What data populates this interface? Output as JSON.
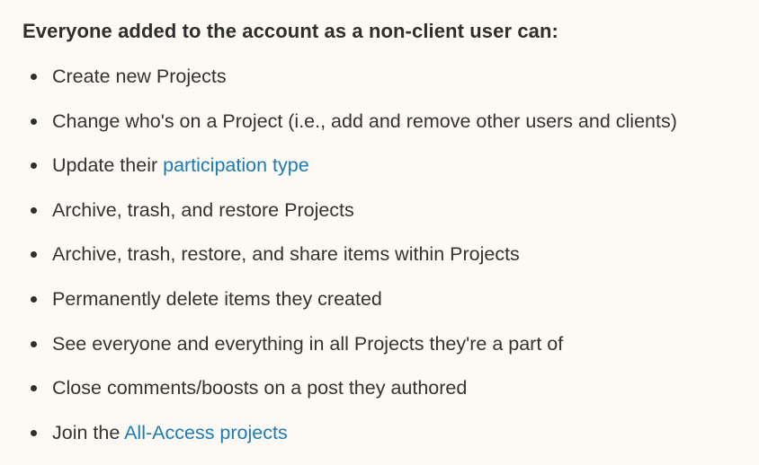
{
  "heading": "Everyone added to the account as a non-client user can:",
  "items": [
    {
      "text": "Create new Projects"
    },
    {
      "text": "Change who's on a Project (i.e., add and remove other users and clients)"
    },
    {
      "prefix": "Update their ",
      "link": "participation type"
    },
    {
      "text": "Archive, trash, and restore Projects"
    },
    {
      "text": "Archive, trash, restore, and share items within Projects"
    },
    {
      "text": "Permanently delete items they created"
    },
    {
      "text": "See everyone and everything in all Projects they're a part of"
    },
    {
      "text": "Close comments/boosts on a post they authored"
    },
    {
      "prefix": "Join the ",
      "link": "All-Access projects"
    }
  ],
  "colors": {
    "background": "#fdfaf5",
    "text": "#333333",
    "link": "#1a7bb5"
  }
}
